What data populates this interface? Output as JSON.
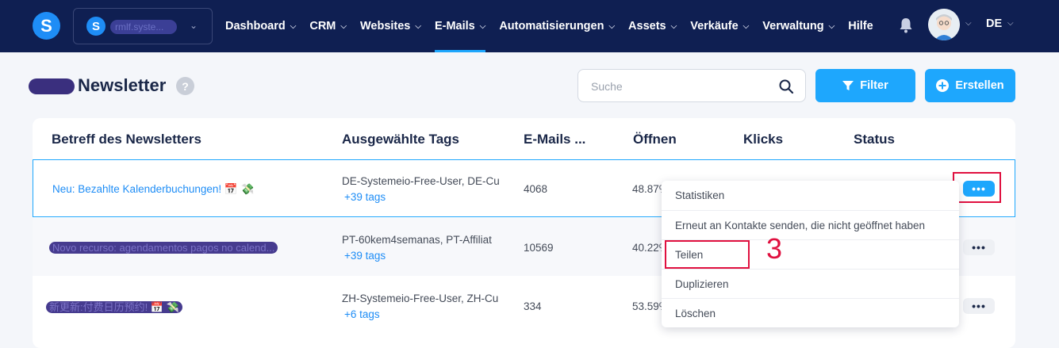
{
  "topbar": {
    "logo_letter": "S",
    "workspace_name": "rmlf.syste...",
    "nav": [
      {
        "label": "Dashboard",
        "has_chevron": true
      },
      {
        "label": "CRM",
        "has_chevron": true
      },
      {
        "label": "Websites",
        "has_chevron": true
      },
      {
        "label": "E-Mails",
        "has_chevron": true,
        "active": true
      },
      {
        "label": "Automatisierungen",
        "has_chevron": true
      },
      {
        "label": "Assets",
        "has_chevron": true
      },
      {
        "label": "Verkäufe",
        "has_chevron": true
      },
      {
        "label": "Verwaltung",
        "has_chevron": true
      },
      {
        "label": "Hilfe",
        "has_chevron": false
      }
    ],
    "language": "DE",
    "icons": {
      "notifications": "bell-icon",
      "user": "avatar"
    }
  },
  "header": {
    "title": "Newsletter",
    "help_icon": "?",
    "search_placeholder": "Suche",
    "filter_label": "Filter",
    "create_label": "Erstellen"
  },
  "table": {
    "columns": [
      "Betreff des Newsletters",
      "Ausgewählte Tags",
      "E-Mails ...",
      "Öffnen",
      "Klicks",
      "Status"
    ],
    "rows": [
      {
        "subject": "Neu: Bezahlte Kalenderbuchungen! 📅 💸",
        "subject_blurred": false,
        "tags": "DE-Systemeio-Free-User, DE-Cu",
        "tags_more": "+39 tags",
        "emails": "4068",
        "opens": "48.87%"
      },
      {
        "subject": "Novo recurso: agendamentos pagos no calend...",
        "subject_blurred": true,
        "tags": "PT-60kem4semanas, PT-Affiliat",
        "tags_more": "+39 tags",
        "emails": "10569",
        "opens": "40.22%"
      },
      {
        "subject": "新更新:付费日历预约! 📅 💸",
        "subject_blurred": true,
        "tags": "ZH-Systemeio-Free-User, ZH-Cu",
        "tags_more": "+6 tags",
        "emails": "334",
        "opens": "53.59%"
      }
    ],
    "more_label": "•••"
  },
  "dropdown": {
    "items": [
      "Statistiken",
      "Erneut an Kontakte senden, die nicht geöffnet haben",
      "Teilen",
      "Duplizieren",
      "Löschen"
    ]
  },
  "annotation": {
    "step_number": "3",
    "highlight_color": "#e0103f"
  },
  "colors": {
    "navbar": "#0f1f52",
    "accent": "#1ea7fd",
    "link": "#1e8df6"
  }
}
